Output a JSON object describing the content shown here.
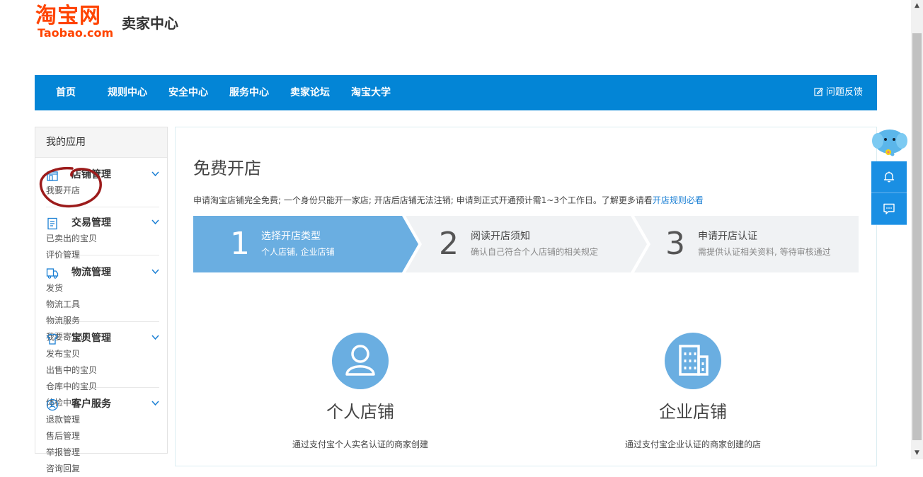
{
  "brand": {
    "logo_cn": "淘宝网",
    "logo_en": "Taobao.com",
    "section_title": "卖家中心",
    "accent_color": "#ff4400",
    "nav_color": "#0385d6"
  },
  "nav": {
    "items": [
      "首页",
      "规则中心",
      "安全中心",
      "服务中心",
      "卖家论坛",
      "淘宝大学"
    ],
    "feedback": "问题反馈"
  },
  "sidebar": {
    "title": "我的应用",
    "groups": [
      {
        "title": "店铺管理",
        "icon": "store-icon",
        "links": [
          "我要开店"
        ]
      },
      {
        "title": "交易管理",
        "icon": "document-icon",
        "links": [
          "已卖出的宝贝",
          "评价管理"
        ]
      },
      {
        "title": "物流管理",
        "icon": "truck-icon",
        "links": [
          "发货",
          "物流工具",
          "物流服务",
          "我要寄快递"
        ]
      },
      {
        "title": "宝贝管理",
        "icon": "shirt-icon",
        "links": [
          "发布宝贝",
          "出售中的宝贝",
          "仓库中的宝贝",
          "体检中心"
        ]
      },
      {
        "title": "客户服务",
        "icon": "user-circle-icon",
        "links": [
          "退款管理",
          "售后管理",
          "举报管理",
          "咨询回复"
        ]
      }
    ]
  },
  "main": {
    "title": "免费开店",
    "notice": "申请淘宝店铺完全免费; 一个身份只能开一家店; 开店后店铺无法注销; 申请到正式开通预计需1~3个工作日。了解更多请看",
    "notice_link": "开店规则必看",
    "steps": [
      {
        "num": "1",
        "title": "选择开店类型",
        "desc": "个人店铺, 企业店铺",
        "active": true
      },
      {
        "num": "2",
        "title": "阅读开店须知",
        "desc": "确认自己符合个人店铺的相关规定",
        "active": false
      },
      {
        "num": "3",
        "title": "申请开店认证",
        "desc": "需提供认证相关资料, 等待审核通过",
        "active": false
      }
    ],
    "shop_types": [
      {
        "name": "个人店铺",
        "icon": "person-icon",
        "desc": "通过支付宝个人实名认证的商家创建"
      },
      {
        "name": "企业店铺",
        "icon": "building-icon",
        "desc": "通过支付宝企业认证的商家创建的店"
      }
    ]
  },
  "float_panel": {
    "mascot": "elephant-mascot",
    "buttons": [
      "bell-icon",
      "chat-icon"
    ]
  }
}
